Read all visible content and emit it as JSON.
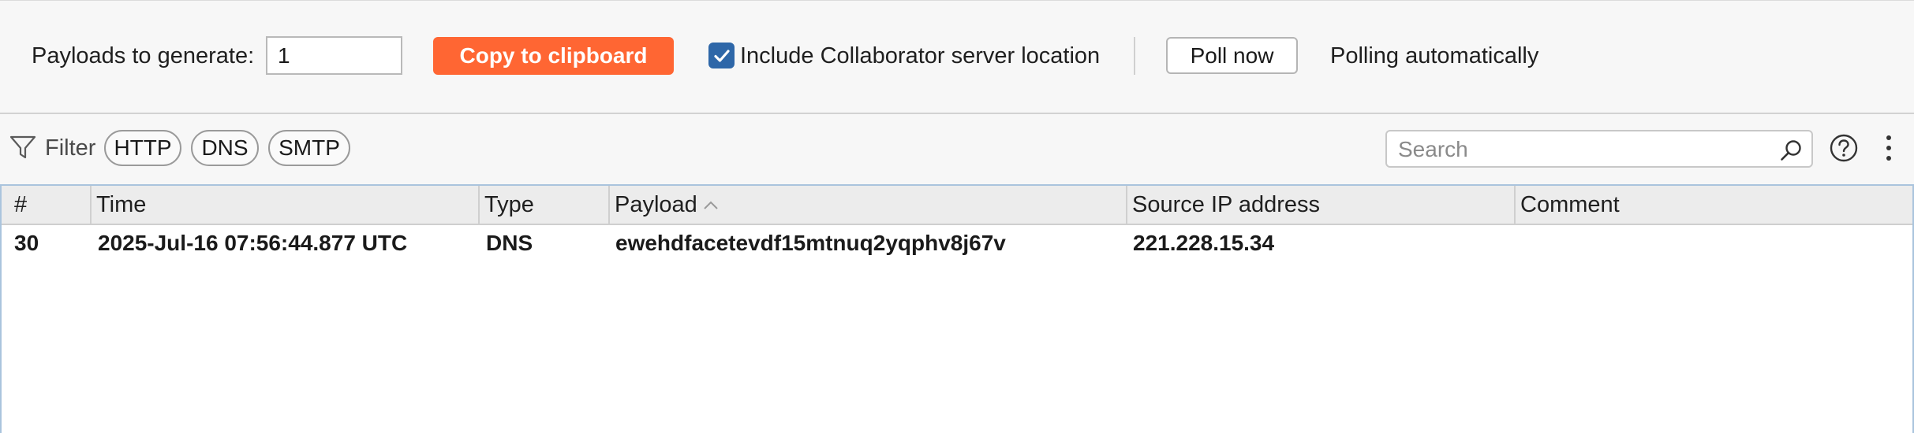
{
  "toolbar": {
    "payloads_label": "Payloads to generate:",
    "payloads_value": "1",
    "copy_label": "Copy to clipboard",
    "include_location_label": "Include Collaborator server location",
    "include_location_checked": true,
    "poll_label": "Poll now",
    "poll_status": "Polling automatically"
  },
  "filter": {
    "label": "Filter",
    "chips": [
      "HTTP",
      "DNS",
      "SMTP"
    ],
    "search_placeholder": "Search",
    "filter_icon": "funnel-icon",
    "search_icon": "magnifier-icon",
    "help_icon": "question-circle-icon",
    "menu_icon": "vertical-dots-icon"
  },
  "table": {
    "columns": [
      "#",
      "Time",
      "Type",
      "Payload",
      "Source IP address",
      "Comment"
    ],
    "sorted_column": "Payload",
    "sort_direction": "ascending",
    "rows": [
      {
        "num": "30",
        "time": "2025-Jul-16 07:56:44.877 UTC",
        "type": "DNS",
        "payload": "ewehdfacetevdf15mtnuq2yqphv8j67v",
        "source_ip": "221.228.15.34",
        "comment": ""
      }
    ]
  },
  "colors": {
    "accent": "#ff6633",
    "checkbox": "#2e67a8",
    "table_border": "#aac4dd"
  }
}
